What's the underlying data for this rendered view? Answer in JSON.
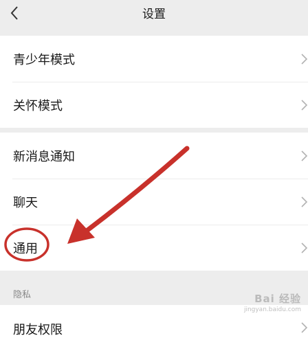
{
  "header": {
    "title": "设置",
    "back_icon": "chevron-left-icon"
  },
  "groups": [
    {
      "items": [
        {
          "label": "青少年模式"
        },
        {
          "label": "关怀模式"
        }
      ]
    },
    {
      "items": [
        {
          "label": "新消息通知"
        },
        {
          "label": "聊天"
        },
        {
          "label": "通用"
        }
      ]
    },
    {
      "section_label": "隐私",
      "items": [
        {
          "label": "朋友权限"
        }
      ]
    }
  ],
  "annotation": {
    "color": "#c8312b",
    "target": "通用"
  },
  "watermark": {
    "main": "Bai 经验",
    "sub": "jingyan.baidu.com"
  },
  "colors": {
    "background": "#ededed",
    "row_background": "#ffffff",
    "text": "#191919",
    "chevron": "#b2b2b2"
  }
}
